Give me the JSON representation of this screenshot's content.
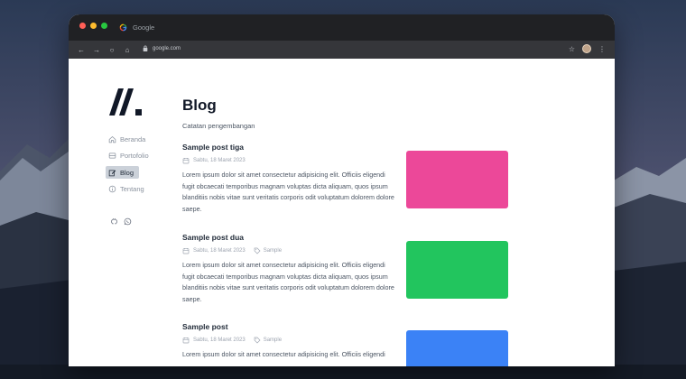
{
  "browser": {
    "tab_title": "Google",
    "url": "google.com"
  },
  "sidebar": {
    "items": [
      {
        "label": "Beranda",
        "icon": "home-icon",
        "active": false
      },
      {
        "label": "Portofolio",
        "icon": "portfolio-icon",
        "active": false
      },
      {
        "label": "Blog",
        "icon": "edit-icon",
        "active": true
      },
      {
        "label": "Tentang",
        "icon": "info-icon",
        "active": false
      }
    ],
    "social": [
      "github-icon",
      "whatsapp-icon"
    ]
  },
  "main": {
    "title": "Blog",
    "subtitle": "Catatan pengembangan",
    "posts": [
      {
        "title": "Sample post tiga",
        "date": "Sabtu, 18 Maret 2023",
        "tag": "",
        "excerpt": "Lorem ipsum dolor sit amet consectetur adipisicing elit. Officiis eligendi fugit obcaecati temporibus magnam voluptas dicta aliquam, quos ipsum blanditiis nobis vitae sunt veritatis corporis odit voluptatum dolorem dolore saepe.",
        "thumb_color": "#ec4899"
      },
      {
        "title": "Sample post dua",
        "date": "Sabtu, 18 Maret 2023",
        "tag": "Sample",
        "excerpt": "Lorem ipsum dolor sit amet consectetur adipisicing elit. Officiis eligendi fugit obcaecati temporibus magnam voluptas dicta aliquam, quos ipsum blanditiis nobis vitae sunt veritatis corporis odit voluptatum dolorem dolore saepe.",
        "thumb_color": "#22c55e"
      },
      {
        "title": "Sample post",
        "date": "Sabtu, 18 Maret 2023",
        "tag": "Sample",
        "excerpt": "Lorem ipsum dolor sit amet consectetur adipisicing elit. Officiis eligendi",
        "thumb_color": "#3b82f6"
      }
    ]
  }
}
